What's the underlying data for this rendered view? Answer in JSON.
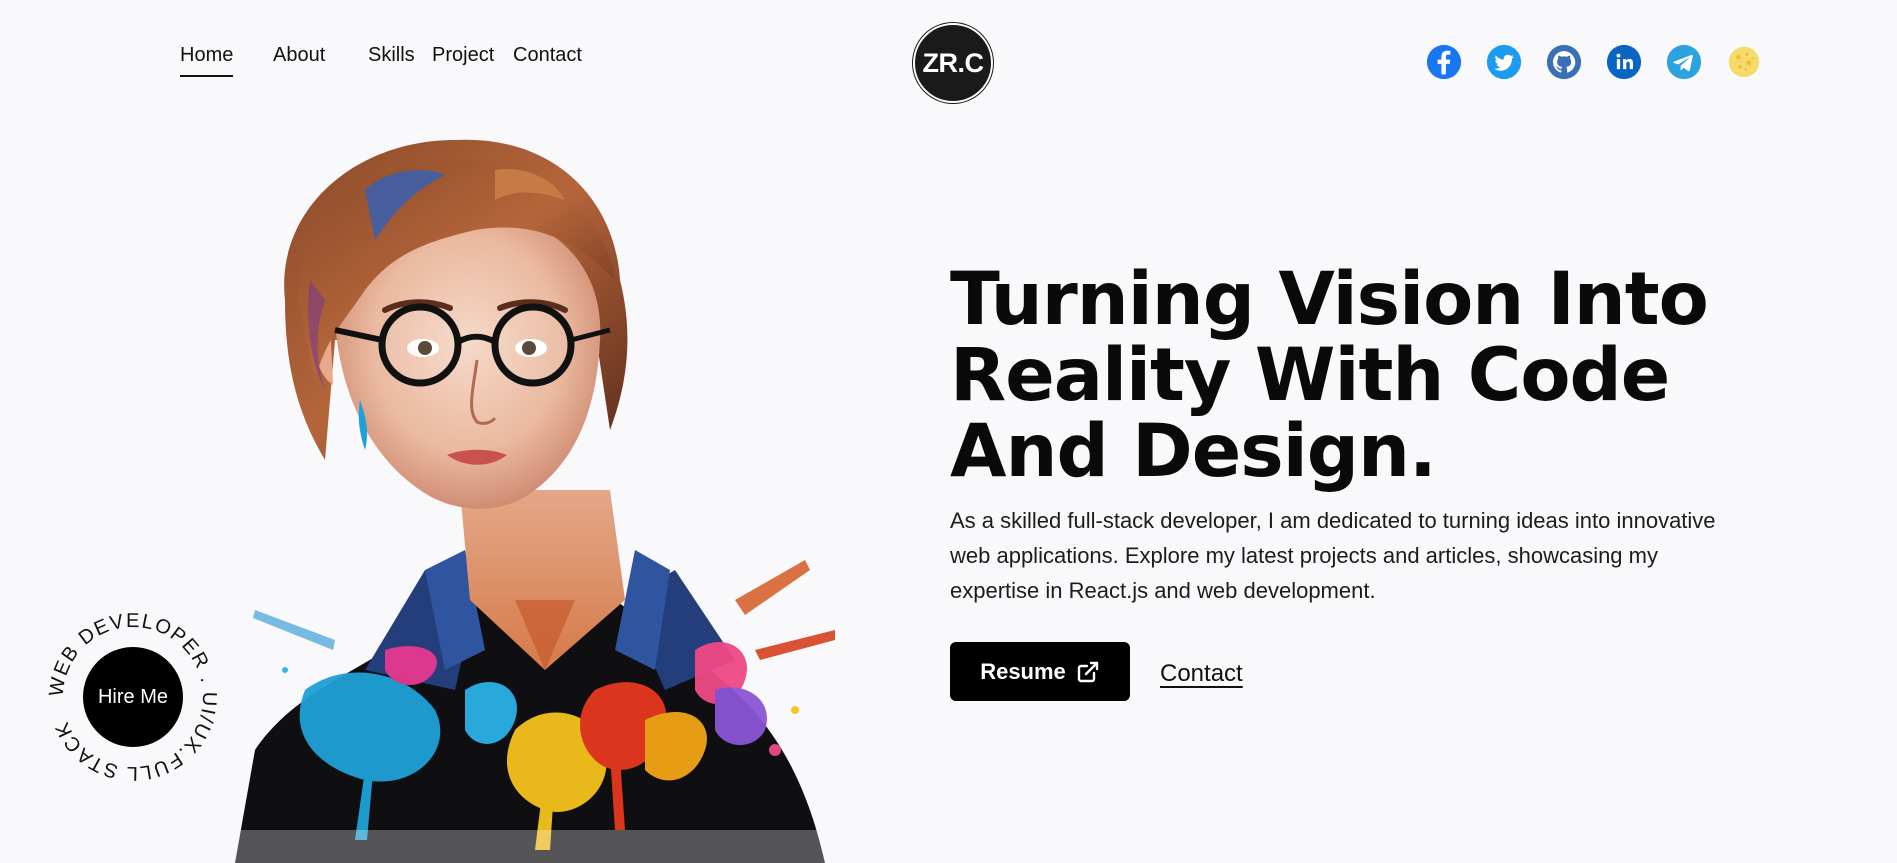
{
  "nav": {
    "links": [
      {
        "label": "Home",
        "active": true
      },
      {
        "label": "About",
        "active": false
      },
      {
        "label": "Skills",
        "active": false
      },
      {
        "label": "Project",
        "active": false
      },
      {
        "label": "Contact",
        "active": false
      }
    ]
  },
  "logo": {
    "text": "ZR.C"
  },
  "socials": [
    {
      "name": "facebook-icon",
      "color": "#1877f2"
    },
    {
      "name": "twitter-icon",
      "color": "#1d9bf0"
    },
    {
      "name": "github-icon",
      "color": "#3b6fb6"
    },
    {
      "name": "linkedin-icon",
      "color": "#0a66c2"
    },
    {
      "name": "telegram-icon",
      "color": "#2aa3df"
    },
    {
      "name": "theme-toggle-icon",
      "color": "#f5d565"
    }
  ],
  "hero": {
    "title": "Turning Vision Into Reality With Code And Design.",
    "description": "As a skilled full-stack developer, I am dedicated to turning ideas into innovative web applications. Explore my latest projects and articles, showcasing my expertise in React.js and web development.",
    "resume_label": "Resume",
    "contact_label": "Contact"
  },
  "hire": {
    "button_label": "Hire Me",
    "ring_text": "WEB DEVELOPER . UI/UX.FULL STACK "
  }
}
